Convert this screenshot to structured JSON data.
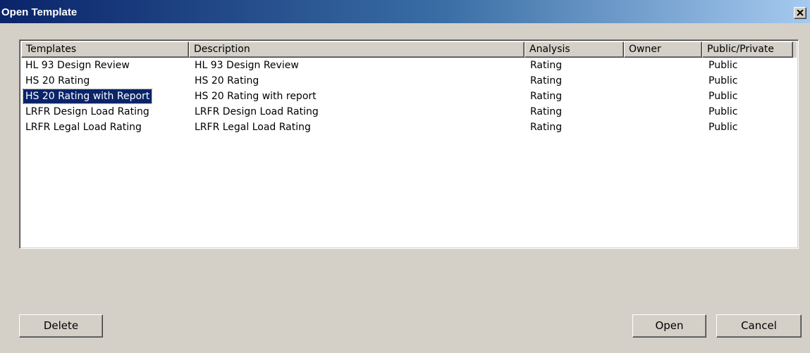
{
  "window": {
    "title": "Open Template"
  },
  "list": {
    "columns": [
      "Templates",
      "Description",
      "Analysis",
      "Owner",
      "Public/Private"
    ],
    "rows": [
      {
        "template": "HL 93 Design Review",
        "description": "HL 93 Design Review",
        "analysis": "Rating",
        "owner": "",
        "visibility": "Public"
      },
      {
        "template": "HS 20 Rating",
        "description": "HS 20 Rating",
        "analysis": "Rating",
        "owner": "",
        "visibility": "Public"
      },
      {
        "template": "HS 20 Rating with Report",
        "description": "HS 20 Rating with report",
        "analysis": "Rating",
        "owner": "",
        "visibility": "Public"
      },
      {
        "template": "LRFR Design Load Rating",
        "description": "LRFR Design Load Rating",
        "analysis": "Rating",
        "owner": "",
        "visibility": "Public"
      },
      {
        "template": "LRFR Legal Load Rating",
        "description": "LRFR Legal Load Rating",
        "analysis": "Rating",
        "owner": "",
        "visibility": "Public"
      }
    ],
    "selected_index": 2
  },
  "buttons": {
    "delete_label": "Delete",
    "open_label": "Open",
    "cancel_label": "Cancel"
  },
  "colors": {
    "titlebar_start": "#0a246a",
    "titlebar_end": "#a6caf0",
    "selection": "#0a246a",
    "dialog_face": "#d4d0c8"
  }
}
